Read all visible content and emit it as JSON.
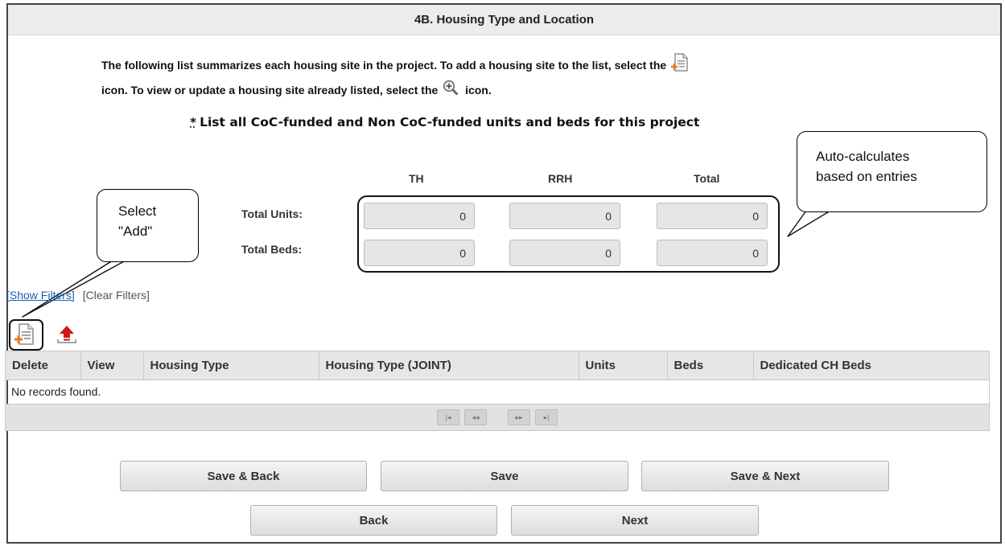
{
  "section": {
    "title": "4B. Housing Type and Location"
  },
  "intro": {
    "line1": "The following list summarizes each housing site in the project. To add a housing site to the list, select the",
    "line2_a": "icon. To view or update a housing site already listed, select the",
    "line2_b": "icon.",
    "add_icon": "add-document-icon",
    "view_icon": "magnify-plus-icon"
  },
  "requirement": {
    "marker": "*",
    "text": "List all CoC-funded and Non CoC-funded units and beds for this project"
  },
  "totals": {
    "columns": [
      "TH",
      "RRH",
      "Total"
    ],
    "rows": [
      {
        "label": "Total Units:",
        "values": [
          "0",
          "0",
          "0"
        ]
      },
      {
        "label": "Total Beds:",
        "values": [
          "0",
          "0",
          "0"
        ]
      }
    ]
  },
  "callouts": {
    "add": {
      "line1": "Select",
      "line2": "\"Add\""
    },
    "auto": {
      "line1": "Auto-calculates",
      "line2": "based on entries"
    }
  },
  "filters": {
    "show": "[Show Filters]",
    "clear": "[Clear Filters]"
  },
  "toolbar": {
    "add_icon": "add-document-icon",
    "export_icon": "upload-icon"
  },
  "grid": {
    "headers": [
      "Delete",
      "View",
      "Housing Type",
      "Housing Type (JOINT)",
      "Units",
      "Beds",
      "Dedicated CH Beds"
    ],
    "empty_message": "No records found.",
    "pager": {
      "first": "|◂",
      "prev": "◂◂",
      "next": "▸▸",
      "last": "▸|"
    }
  },
  "buttons": {
    "save_back": "Save & Back",
    "save": "Save",
    "save_next": "Save & Next",
    "back": "Back",
    "next": "Next"
  },
  "colors": {
    "link": "#1a5fb4",
    "add_icon_accent": "#f07a1a",
    "export_icon_accent": "#d01818"
  }
}
